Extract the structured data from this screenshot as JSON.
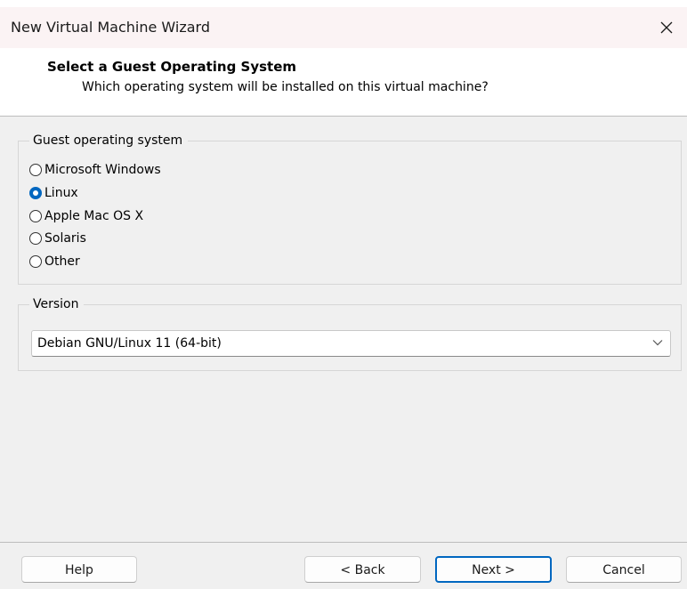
{
  "window": {
    "title": "New Virtual Machine Wizard",
    "close_icon": "close-icon"
  },
  "header": {
    "title": "Select a Guest Operating System",
    "subtitle": "Which operating system will be installed on this virtual machine?"
  },
  "guest_os": {
    "legend": "Guest operating system",
    "selected": "Linux",
    "options": [
      {
        "label": "Microsoft Windows",
        "checked": false
      },
      {
        "label": "Linux",
        "checked": true
      },
      {
        "label": "Apple Mac OS X",
        "checked": false
      },
      {
        "label": "Solaris",
        "checked": false
      },
      {
        "label": "Other",
        "checked": false
      }
    ]
  },
  "version": {
    "legend": "Version",
    "value": "Debian GNU/Linux 11 (64-bit)",
    "dropdown_icon": "chevron-down-icon"
  },
  "buttons": {
    "help": "Help",
    "back": "< Back",
    "next": "Next >",
    "cancel": "Cancel"
  },
  "colors": {
    "accent": "#0067c0",
    "titlebar": "#fbf3f4",
    "panel": "#f0f0f0"
  }
}
